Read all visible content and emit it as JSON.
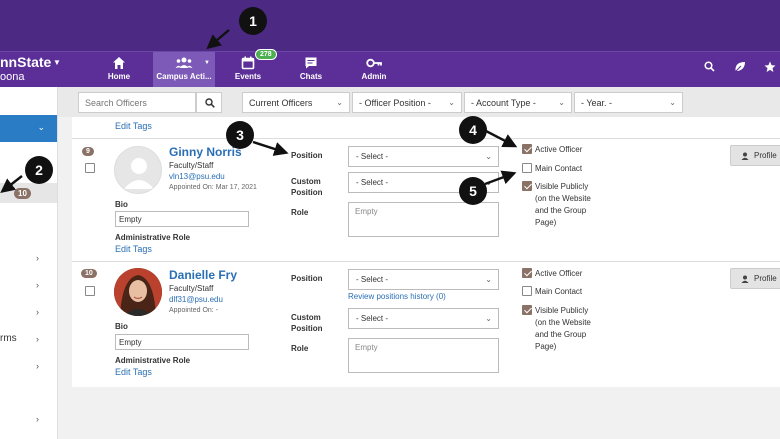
{
  "header": {
    "brand": "nnState",
    "brand_sub": "oona",
    "nav": [
      {
        "label": "Home",
        "icon": "home-icon"
      },
      {
        "label": "Campus Acti...",
        "icon": "users-icon"
      },
      {
        "label": "Events",
        "icon": "calendar-icon",
        "badge": "278"
      },
      {
        "label": "Chats",
        "icon": "chat-icon"
      },
      {
        "label": "Admin",
        "icon": "key-icon"
      }
    ]
  },
  "sidebar": {
    "count_badge": "10",
    "partial_text": "rms"
  },
  "filters": {
    "search_placeholder": "Search Officers",
    "officers": "Current Officers",
    "position": "- Officer Position -",
    "account_type": "- Account Type -",
    "year": "- Year. -"
  },
  "top_edit_tags": "Edit Tags",
  "labels": {
    "position": "Position",
    "custom": "Custom",
    "position2": "Position",
    "role": "Role",
    "bio": "Bio",
    "admin_role": "Administrative Role",
    "edit_tags": "Edit Tags",
    "select": "- Select -",
    "empty": "Empty",
    "active_officer": "Active Officer",
    "main_contact": "Main Contact",
    "visible_publicly_1": "Visible Publicly",
    "visible_publicly_2": "(on the Website",
    "visible_publicly_3": "and the Group",
    "visible_publicly_4": "Page)",
    "profile": "Profile",
    "review_history": "Review positions history (0)"
  },
  "officers": [
    {
      "rank": "9",
      "name": "Ginny Norris",
      "type": "Faculty/Staff",
      "email": "vln13@psu.edu",
      "appointed": "Appointed On: Mar 17, 2021",
      "bio": "Empty",
      "active": true,
      "main_contact": false,
      "visible": true
    },
    {
      "rank": "10",
      "name": "Danielle Fry",
      "type": "Faculty/Staff",
      "email": "dlf31@psu.edu",
      "appointed": "Appointed On: -",
      "bio": "Empty",
      "active": true,
      "main_contact": false,
      "visible": true
    }
  ],
  "callouts": [
    "1",
    "2",
    "3",
    "4",
    "5"
  ]
}
